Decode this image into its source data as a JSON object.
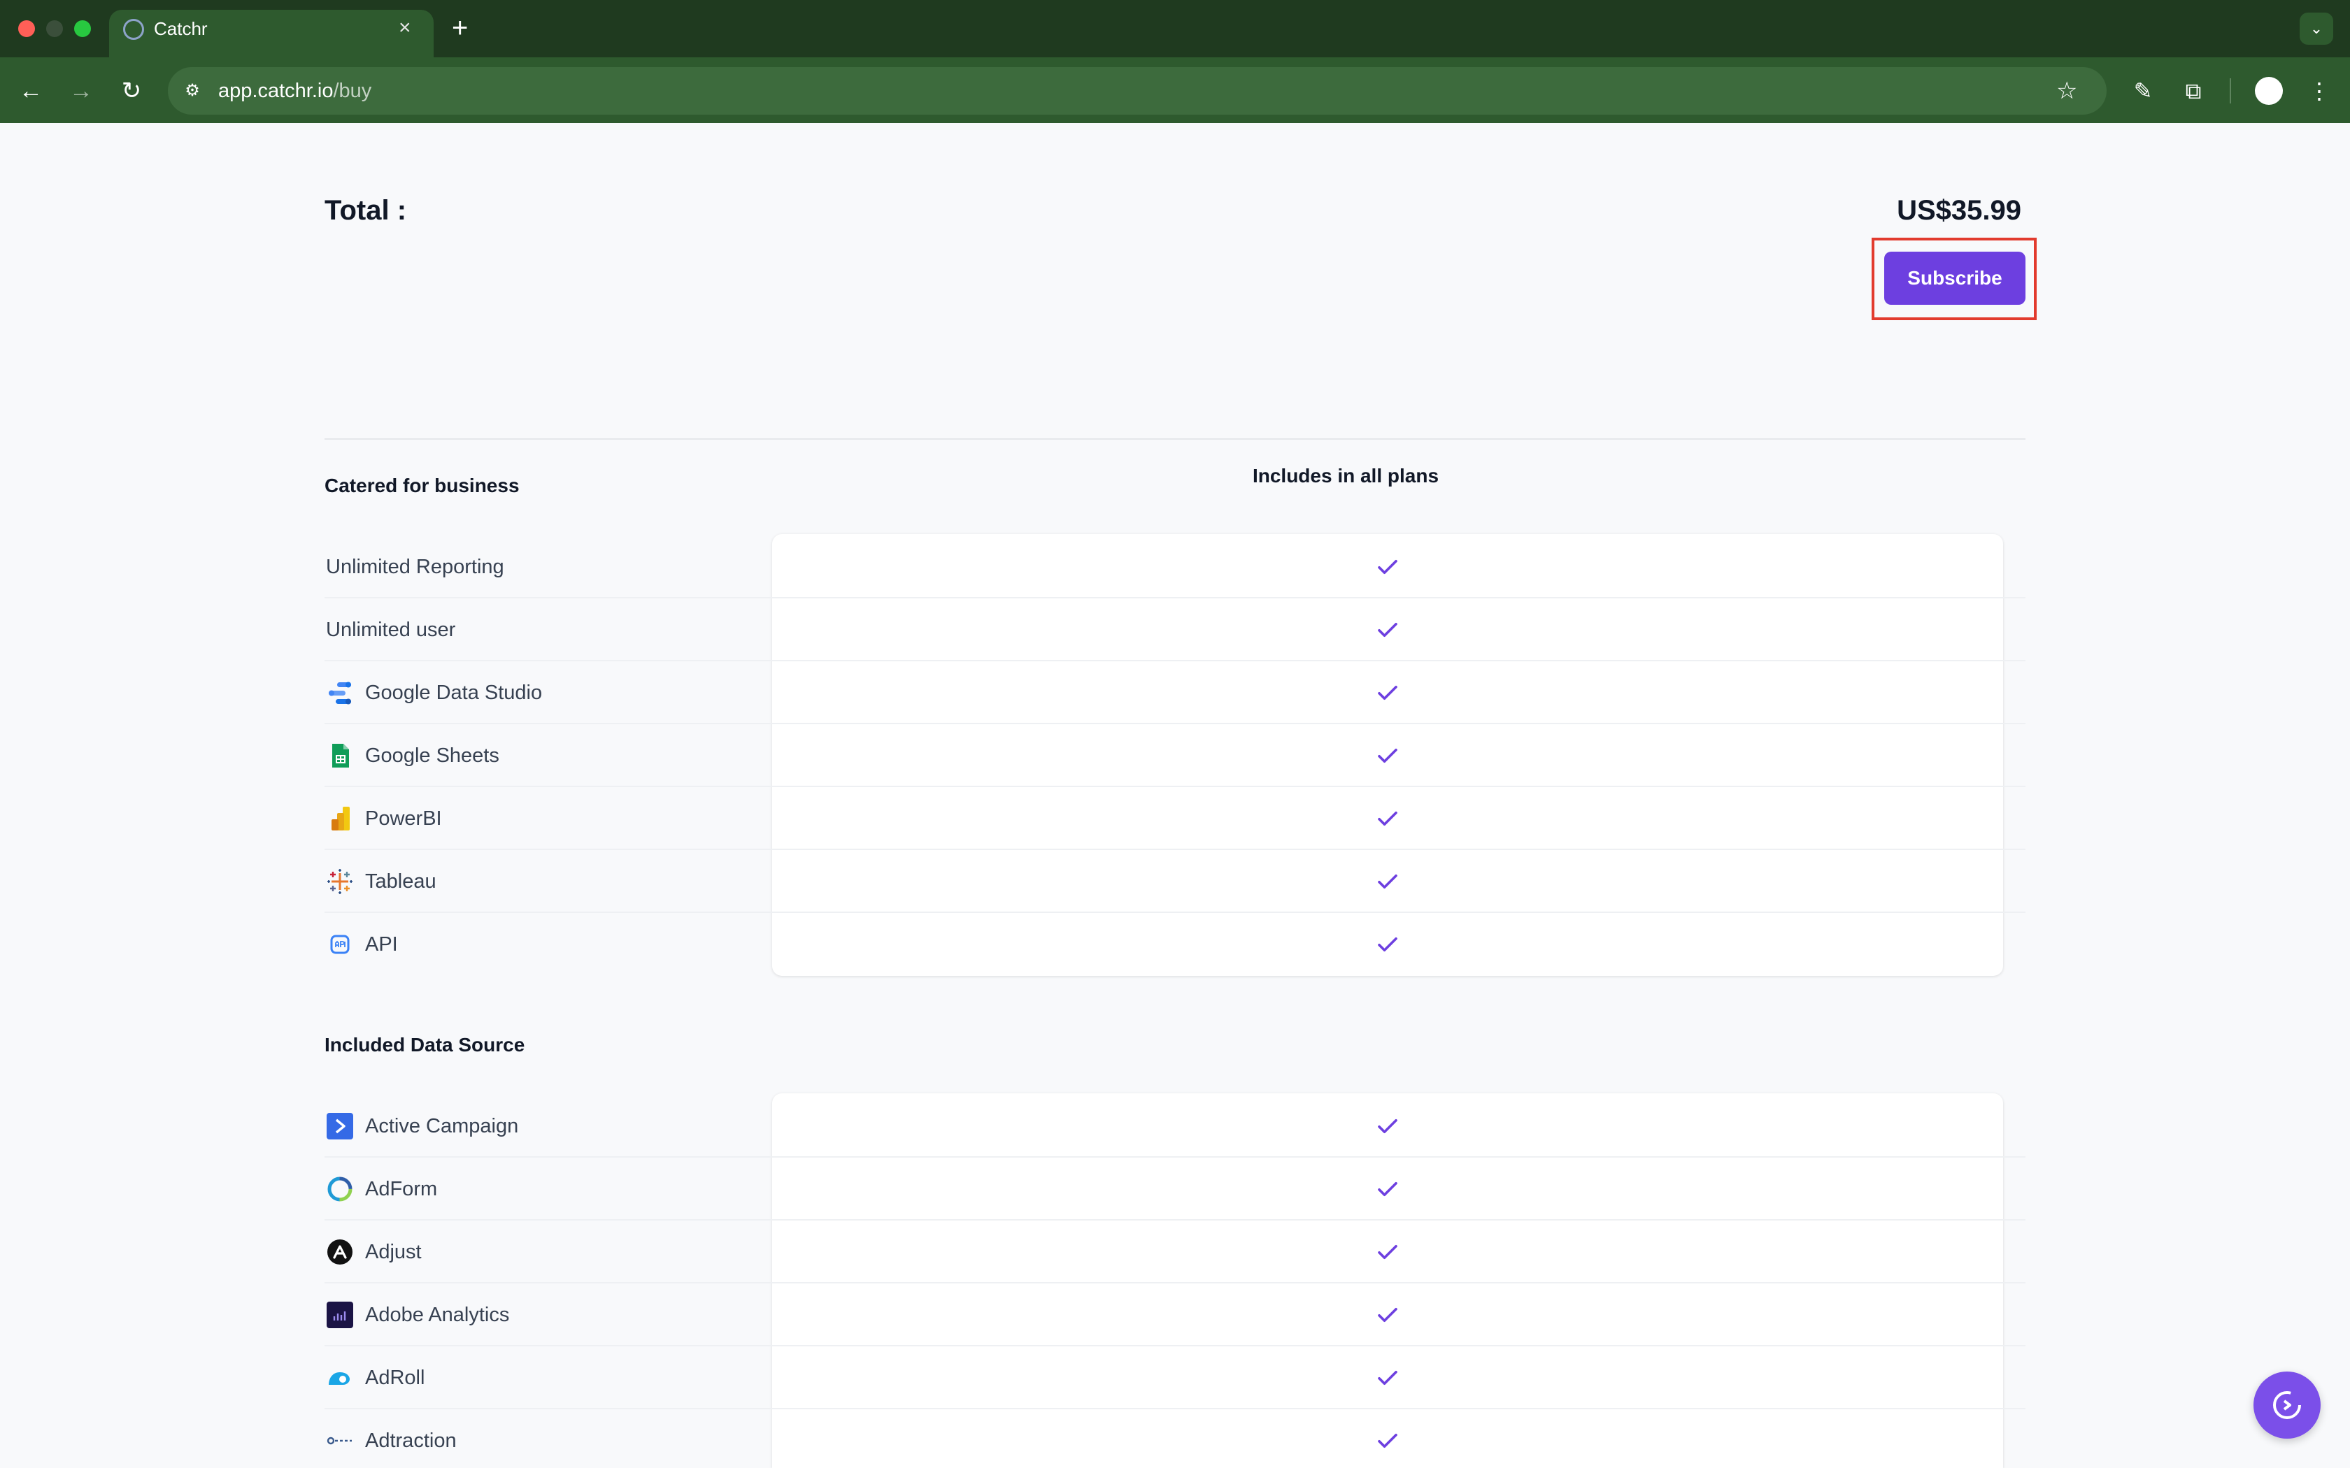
{
  "browser": {
    "tab_title": "Catchr",
    "tab_close_glyph": "×",
    "new_tab_glyph": "+",
    "url_host": "app.catchr.io",
    "url_path": "/buy"
  },
  "checkout": {
    "total_label": "Total :",
    "total_price": "US$35.99",
    "subscribe_label": "Subscribe"
  },
  "business_section": {
    "title": "Catered for business",
    "column_header": "Includes in all plans",
    "rows": [
      {
        "label": "Unlimited Reporting",
        "icon": null,
        "included": true
      },
      {
        "label": "Unlimited user",
        "icon": null,
        "included": true
      },
      {
        "label": "Google Data Studio",
        "icon": "google-data-studio-icon",
        "included": true
      },
      {
        "label": "Google Sheets",
        "icon": "google-sheets-icon",
        "included": true
      },
      {
        "label": "PowerBI",
        "icon": "powerbi-icon",
        "included": true
      },
      {
        "label": "Tableau",
        "icon": "tableau-icon",
        "included": true
      },
      {
        "label": "API",
        "icon": "api-icon",
        "included": true
      }
    ]
  },
  "datasource_section": {
    "title": "Included Data Source",
    "rows": [
      {
        "label": "Active Campaign",
        "icon": "active-campaign-icon",
        "included": true
      },
      {
        "label": "AdForm",
        "icon": "adform-icon",
        "included": true
      },
      {
        "label": "Adjust",
        "icon": "adjust-icon",
        "included": true
      },
      {
        "label": "Adobe Analytics",
        "icon": "adobe-analytics-icon",
        "included": true
      },
      {
        "label": "AdRoll",
        "icon": "adroll-icon",
        "included": true
      },
      {
        "label": "Adtraction",
        "icon": "adtraction-icon",
        "included": true
      }
    ]
  },
  "colors": {
    "accent": "#6d3fe0",
    "check": "#6d3fe0",
    "highlight_frame": "#e23b2e",
    "browser_frame": "#1f3a1f"
  }
}
